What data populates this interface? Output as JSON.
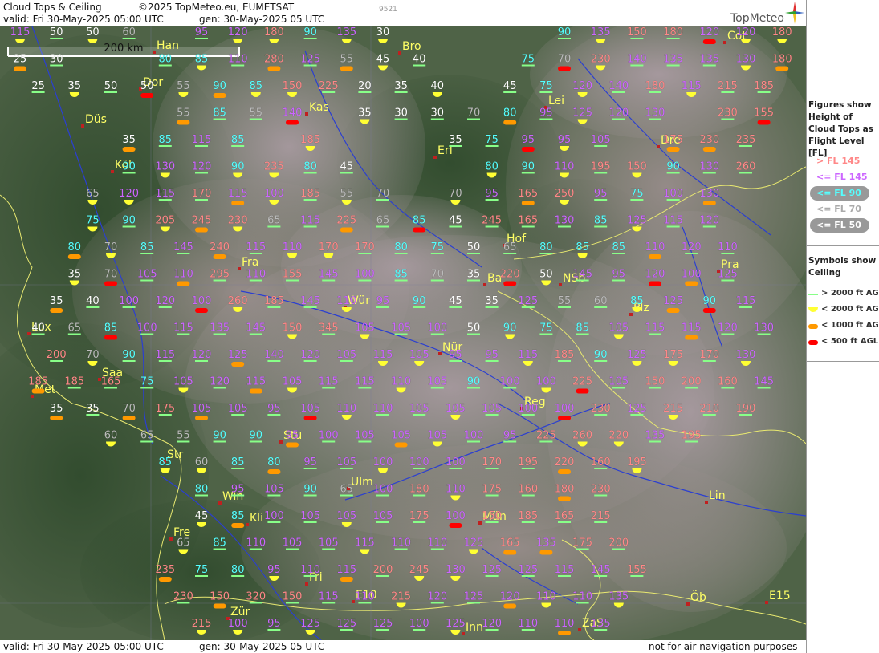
{
  "header": {
    "title": "Cloud Tops & Ceiling",
    "copyright": "©2025 TopMeteo.eu, EUMETSAT",
    "valid": "valid:  Fri  30-May-2025  05:00 UTC",
    "generated": "gen: 30-May-2025 05 UTC",
    "code": "9521",
    "brand": "TopMeteo"
  },
  "footer": {
    "valid": "valid:  Fri  30-May-2025  05:00 UTC",
    "generated": "gen: 30-May-2025 05 UTC",
    "disclaimer": "not for air navigation purposes"
  },
  "scale_bar": "200 km",
  "legend": {
    "figures_title": "Figures show Height of Cloud Tops as Flight Level  [FL]",
    "figures": [
      {
        "label": "> FL 145",
        "color": "#ff8888"
      },
      {
        "label": "<= FL 145",
        "color": "#cc66ff"
      },
      {
        "label": "<= FL 90",
        "color": "#55ffff"
      },
      {
        "label": "<= FL 70",
        "color": "#aaaaaa"
      },
      {
        "label": "<= FL 50",
        "color": "#ffffff"
      }
    ],
    "symbols_title": "Symbols show Ceiling",
    "symbols": [
      {
        "label": "> 2000 ft AGL",
        "color": "#88ff88",
        "shape": "line"
      },
      {
        "label": "< 2000 ft AGL",
        "color": "#ffff33",
        "shape": "half-circle"
      },
      {
        "label": "< 1000 ft AGL",
        "color": "#ff9900",
        "shape": "pill"
      },
      {
        "label": "< 500 ft AGL",
        "color": "#ff0000",
        "shape": "pill"
      }
    ]
  },
  "cities": [
    "Han",
    "Bro",
    "Dor",
    "Kas",
    "Düs",
    "Lei",
    "Erf",
    "Cot",
    "Köl",
    "Dre",
    "Hof",
    "Fra",
    "Pra",
    "Ba",
    "NSb",
    "Wür",
    "Plz",
    "Lux",
    "Nür",
    "Saa",
    "Met",
    "Reg",
    "Stu",
    "Str",
    "Ulm",
    "Lin",
    "Win",
    "Kli",
    "Mün",
    "Fre",
    "Fri",
    "E10",
    "Inn",
    "Zür",
    "ZaS",
    "Öb",
    "E15"
  ],
  "grid": [
    [
      115,
      50,
      50,
      60,
      null,
      95,
      120,
      180,
      90,
      135,
      30,
      null,
      null,
      null,
      null,
      90,
      135,
      150,
      180,
      120,
      120,
      180
    ],
    [
      25,
      30,
      null,
      null,
      80,
      85,
      110,
      280,
      125,
      55,
      45,
      40,
      null,
      null,
      75,
      70,
      230,
      140,
      135,
      135,
      130,
      180
    ],
    [
      25,
      35,
      50,
      50,
      55,
      90,
      85,
      150,
      225,
      20,
      35,
      40,
      null,
      45,
      75,
      120,
      140,
      180,
      115,
      215,
      185
    ],
    [
      null,
      null,
      null,
      null,
      55,
      85,
      55,
      140,
      null,
      35,
      30,
      30,
      70,
      80,
      95,
      125,
      120,
      130,
      null,
      230,
      155
    ],
    [
      null,
      null,
      35,
      85,
      115,
      85,
      null,
      185,
      null,
      null,
      null,
      35,
      75,
      95,
      95,
      105,
      null,
      175,
      230,
      235
    ],
    [
      null,
      null,
      90,
      130,
      120,
      90,
      235,
      80,
      45,
      null,
      null,
      null,
      80,
      90,
      110,
      195,
      150,
      90,
      130,
      260
    ],
    [
      65,
      120,
      115,
      170,
      115,
      100,
      185,
      55,
      70,
      null,
      70,
      95,
      165,
      250,
      95,
      75,
      100,
      130
    ],
    [
      75,
      90,
      205,
      245,
      230,
      65,
      115,
      225,
      65,
      85,
      45,
      245,
      165,
      130,
      85,
      125,
      115,
      120
    ],
    [
      80,
      70,
      85,
      145,
      240,
      115,
      110,
      170,
      170,
      80,
      75,
      50,
      65,
      80,
      85,
      85,
      110,
      120,
      110
    ],
    [
      35,
      70,
      105,
      110,
      295,
      110,
      155,
      145,
      100,
      85,
      70,
      35,
      220,
      50,
      145,
      95,
      120,
      100,
      125
    ],
    [
      35,
      40,
      100,
      120,
      100,
      260,
      185,
      145,
      110,
      95,
      90,
      45,
      35,
      125,
      55,
      60,
      85,
      125,
      90,
      115
    ],
    [
      40,
      65,
      85,
      100,
      115,
      135,
      145,
      150,
      345,
      105,
      105,
      100,
      50,
      90,
      75,
      85,
      105,
      115,
      115,
      120,
      130
    ],
    [
      200,
      70,
      90,
      115,
      120,
      125,
      140,
      120,
      105,
      115,
      105,
      95,
      95,
      115,
      185,
      90,
      125,
      175,
      170,
      130
    ],
    [
      185,
      185,
      165,
      75,
      105,
      120,
      115,
      105,
      115,
      115,
      110,
      105,
      90,
      100,
      100,
      225,
      105,
      150,
      200,
      160,
      145
    ],
    [
      35,
      35,
      70,
      175,
      105,
      105,
      95,
      105,
      110,
      110,
      105,
      105,
      105,
      100,
      100,
      230,
      125,
      215,
      210,
      190
    ],
    [
      60,
      65,
      55,
      90,
      90,
      95,
      100,
      105,
      105,
      105,
      100,
      95,
      225,
      260,
      220,
      135,
      195
    ],
    [
      85,
      60,
      85,
      80,
      95,
      105,
      100,
      100,
      100,
      170,
      195,
      220,
      160,
      195
    ],
    [
      80,
      95,
      105,
      90,
      65,
      100,
      180,
      110,
      175,
      160,
      180,
      230
    ],
    [
      45,
      85,
      100,
      105,
      105,
      105,
      175,
      100,
      150,
      185,
      165,
      215
    ],
    [
      65,
      85,
      110,
      105,
      105,
      115,
      110,
      110,
      125,
      165,
      135,
      175,
      200
    ],
    [
      235,
      75,
      80,
      95,
      110,
      115,
      200,
      245,
      130,
      125,
      125,
      115,
      145,
      155
    ],
    [
      230,
      150,
      320,
      150,
      115,
      110,
      215,
      120,
      125,
      120,
      110,
      110,
      135
    ],
    [
      215,
      100,
      95,
      125,
      125,
      125,
      100,
      125,
      120,
      110,
      110,
      135
    ]
  ]
}
